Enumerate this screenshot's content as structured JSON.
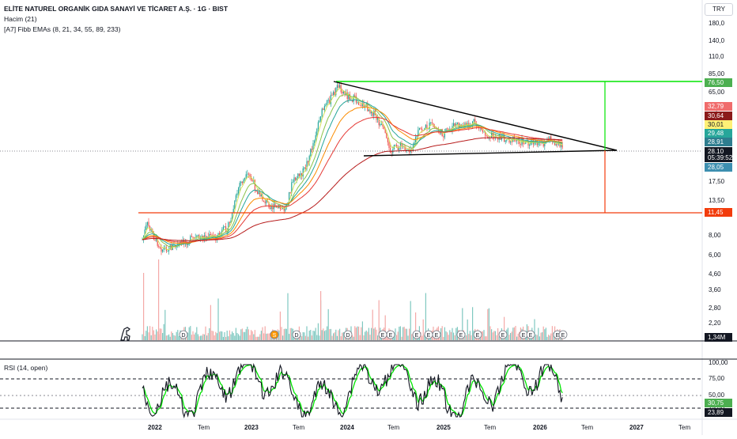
{
  "chart_title": "ELİTE NATUREL ORGANİK GIDA SANAYİ VE TİCARET A.Ş. · 1G · BIST",
  "volume_label": "Hacim (21)",
  "ema_label": "[A7] Fibb EMAs (8, 21, 34, 55, 89, 233)",
  "currency": "TRY",
  "rsi_label": "RSI (14, open)",
  "price_axis_ticks": [
    "180,0",
    "140,0",
    "110,0",
    "85,00",
    "65,00",
    "45,00",
    "17,50",
    "13,50",
    "8,00",
    "6,00",
    "4,60",
    "3,60",
    "2,80",
    "2,20"
  ],
  "price_labels": [
    {
      "text": "76,50",
      "bg": "#4caf50",
      "fg": "#ffffff"
    },
    {
      "text": "32,79",
      "bg": "#f06c6c",
      "fg": "#ffffff"
    },
    {
      "text": "30,64",
      "bg": "#8b1a1a",
      "fg": "#ffffff"
    },
    {
      "text": "30,01",
      "bg": "#fff176",
      "fg": "#131722"
    },
    {
      "text": "29,48",
      "bg": "#26a69a",
      "fg": "#ffffff"
    },
    {
      "text": "28,91",
      "bg": "#2e7d8f",
      "fg": "#ffffff"
    },
    {
      "text": "28,10",
      "bg": "#131722",
      "fg": "#ffffff"
    },
    {
      "text": "05:39:52",
      "bg": "#131722",
      "fg": "#ffffff"
    },
    {
      "text": "28,05",
      "bg": "#3d8fb0",
      "fg": "#ffffff"
    },
    {
      "text": "11,45",
      "bg": "#f23c0c",
      "fg": "#ffffff"
    },
    {
      "text": "1,34M",
      "bg": "#131722",
      "fg": "#ffffff"
    }
  ],
  "rsi_axis_ticks": [
    "100,00",
    "75,00",
    "50,00",
    "25,00"
  ],
  "rsi_labels": [
    {
      "text": "30,75",
      "bg": "#4caf50",
      "fg": "#ffffff"
    },
    {
      "text": "23,89",
      "bg": "#131722",
      "fg": "#ffffff"
    }
  ],
  "time_labels": [
    "2022",
    "Tem",
    "2023",
    "Tem",
    "2024",
    "Tem",
    "2025",
    "Tem",
    "2026",
    "Tem",
    "2027",
    "Tem"
  ],
  "event_badges": [
    "D",
    "S",
    "D",
    "D",
    "E",
    "E",
    "E",
    "E",
    "E",
    "E",
    "E",
    "E",
    "E",
    "E",
    "E",
    "E"
  ],
  "colors": {
    "green_line": "#00e600",
    "red_line": "#f23c0c",
    "triangle": "#000000",
    "up": "#26a69a",
    "down": "#ef5350"
  }
}
